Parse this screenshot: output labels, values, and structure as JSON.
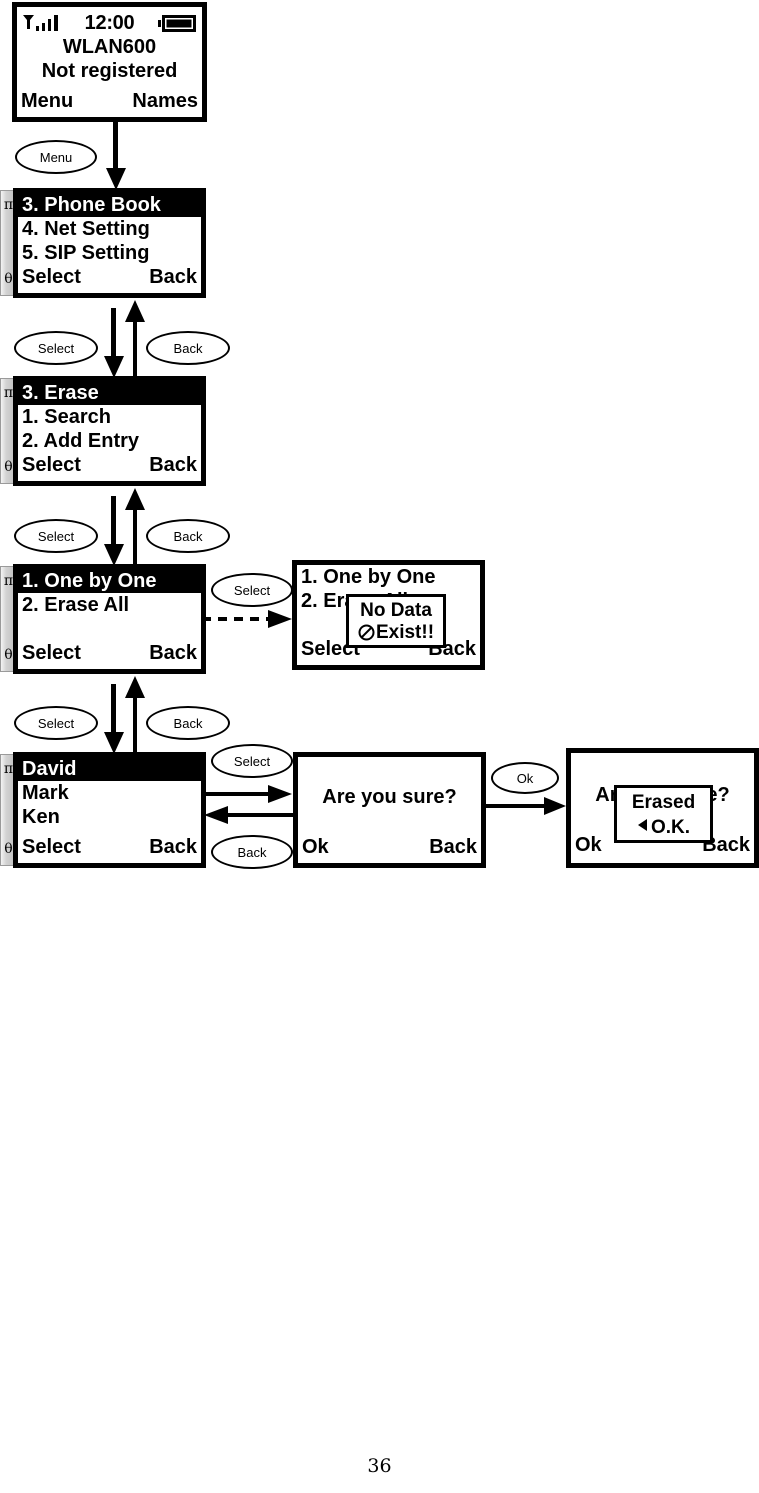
{
  "page": {
    "number": "36"
  },
  "status_bar": {
    "signal_icon": "signal-bars-icon",
    "clock": "12:00",
    "battery_icon": "battery-full-icon"
  },
  "screens": {
    "idle": {
      "name": "WLAN600",
      "registration": "Not registered",
      "softkey_left": "Menu",
      "softkey_right": "Names"
    },
    "main_menu": {
      "rows": [
        {
          "label": "3. Phone Book",
          "selected": true
        },
        {
          "label": "4. Net Setting",
          "selected": false
        },
        {
          "label": "5. SIP Setting",
          "selected": false
        }
      ],
      "softkey_left": "Select",
      "softkey_right": "Back",
      "scroll_up": "π",
      "scroll_down": "θ"
    },
    "phone_book_menu": {
      "rows": [
        {
          "label": "3. Erase",
          "selected": true
        },
        {
          "label": "1. Search",
          "selected": false
        },
        {
          "label": "2. Add Entry",
          "selected": false
        }
      ],
      "softkey_left": "Select",
      "softkey_right": "Back",
      "scroll_up": "π",
      "scroll_down": "θ"
    },
    "erase_menu": {
      "rows": [
        {
          "label": "1. One by One",
          "selected": true
        },
        {
          "label": "2. Erase All",
          "selected": false
        }
      ],
      "softkey_left": "Select",
      "softkey_right": "Back",
      "scroll_up": "π",
      "scroll_down": "θ"
    },
    "erase_menu_no_data": {
      "rows": [
        {
          "label": "1. One by One",
          "selected": false
        },
        {
          "label": "2. Erase All",
          "selected": false
        }
      ],
      "softkey_left": "Select",
      "softkey_right": "Back",
      "popup": {
        "line1": "No Data",
        "line2": "Exist!!",
        "icon": "no-entry-icon"
      }
    },
    "name_list": {
      "rows": [
        {
          "label": "David",
          "selected": true
        },
        {
          "label": "Mark",
          "selected": false
        },
        {
          "label": "Ken",
          "selected": false
        }
      ],
      "softkey_left": "Select",
      "softkey_right": "Back",
      "scroll_up": "π",
      "scroll_down": "θ"
    },
    "confirm": {
      "prompt": "Are you sure?",
      "softkey_left": "Ok",
      "softkey_right": "Back"
    },
    "erased_ok": {
      "prompt": "Are you sure?",
      "softkey_left": "Ok",
      "softkey_right": "Back",
      "popup": {
        "line1": "Erased",
        "line2": "O.K.",
        "icon": "left-triangle-icon"
      }
    }
  },
  "bubbles": {
    "menu": "Menu",
    "select1": "Select",
    "back1": "Back",
    "select2": "Select",
    "back2": "Back",
    "select3": "Select",
    "back3": "Back",
    "select_nodata": "Select",
    "select_confirm": "Select",
    "back_confirm": "Back",
    "ok": "Ok"
  },
  "colors": {
    "ink": "#000000",
    "paper": "#ffffff",
    "scrollbar": "#c8c8c8"
  }
}
